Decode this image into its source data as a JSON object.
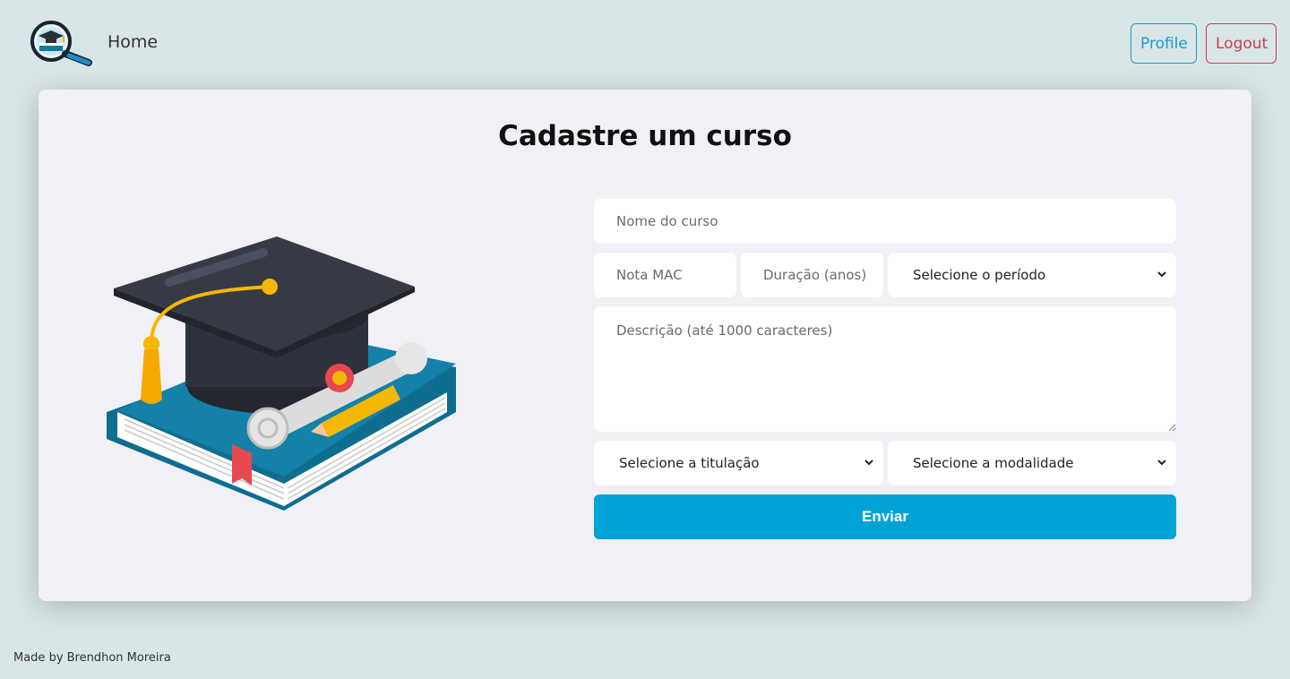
{
  "nav": {
    "logo_icon": "graduation-magnifier-logo",
    "home_label": "Home",
    "profile_label": "Profile",
    "logout_label": "Logout",
    "profile_color": "#1b9bc4",
    "logout_color": "#c8404a"
  },
  "card": {
    "title": "Cadastre um curso",
    "illustration_icon": "graduation-cap-book-diploma"
  },
  "form": {
    "nome_placeholder": "Nome do curso",
    "nota_placeholder": "Nota MAC",
    "duracao_placeholder": "Duração (anos)",
    "periodo_selected": "Selecione o período",
    "descricao_placeholder": "Descrição (até 1000 caracteres)",
    "titulacao_selected": "Selecione a titulação",
    "modalidade_selected": "Selecione a modalidade",
    "submit_label": "Enviar",
    "submit_color": "#00a3d6"
  },
  "footer": {
    "text": "Made by Brendhon Moreira"
  }
}
